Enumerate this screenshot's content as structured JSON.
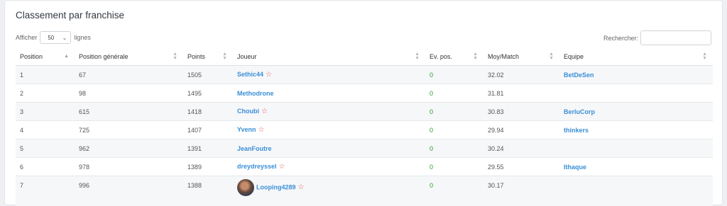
{
  "title": "Classement par franchise",
  "length_control": {
    "prefix": "Afficher",
    "value": "50",
    "suffix": "lignes"
  },
  "search_label": "Rechercher:",
  "columns": [
    "Position",
    "Position générale",
    "Points",
    "Joueur",
    "Ev. pos.",
    "Moy/Match",
    "Equipe"
  ],
  "rows": [
    {
      "position": "1",
      "general": "67",
      "points": "1505",
      "player": "Sethic44",
      "star": true,
      "ev": "0",
      "avg": "32.02",
      "team": "BetDeSen"
    },
    {
      "position": "2",
      "general": "98",
      "points": "1495",
      "player": "Methodrone",
      "star": false,
      "ev": "0",
      "avg": "31.81",
      "team": ""
    },
    {
      "position": "3",
      "general": "615",
      "points": "1418",
      "player": "Choubi",
      "star": true,
      "ev": "0",
      "avg": "30.83",
      "team": "BerluCorp"
    },
    {
      "position": "4",
      "general": "725",
      "points": "1407",
      "player": "Yvenn",
      "star": true,
      "ev": "0",
      "avg": "29.94",
      "team": "thinkers"
    },
    {
      "position": "5",
      "general": "962",
      "points": "1391",
      "player": "JeanFoutre",
      "star": false,
      "ev": "0",
      "avg": "30.24",
      "team": ""
    },
    {
      "position": "6",
      "general": "978",
      "points": "1389",
      "player": "dreydreyssel",
      "star": true,
      "ev": "0",
      "avg": "29.55",
      "team": "Ithaque"
    },
    {
      "position": "7",
      "general": "996",
      "points": "1388",
      "player": "Looping4289",
      "star": true,
      "ev": "0",
      "avg": "30.17",
      "team": "",
      "avatar": true
    }
  ],
  "star_glyph": "☆",
  "colors": {
    "link": "#3a8fd6",
    "positive": "#2e9b2e",
    "star": "#e05a5a"
  }
}
